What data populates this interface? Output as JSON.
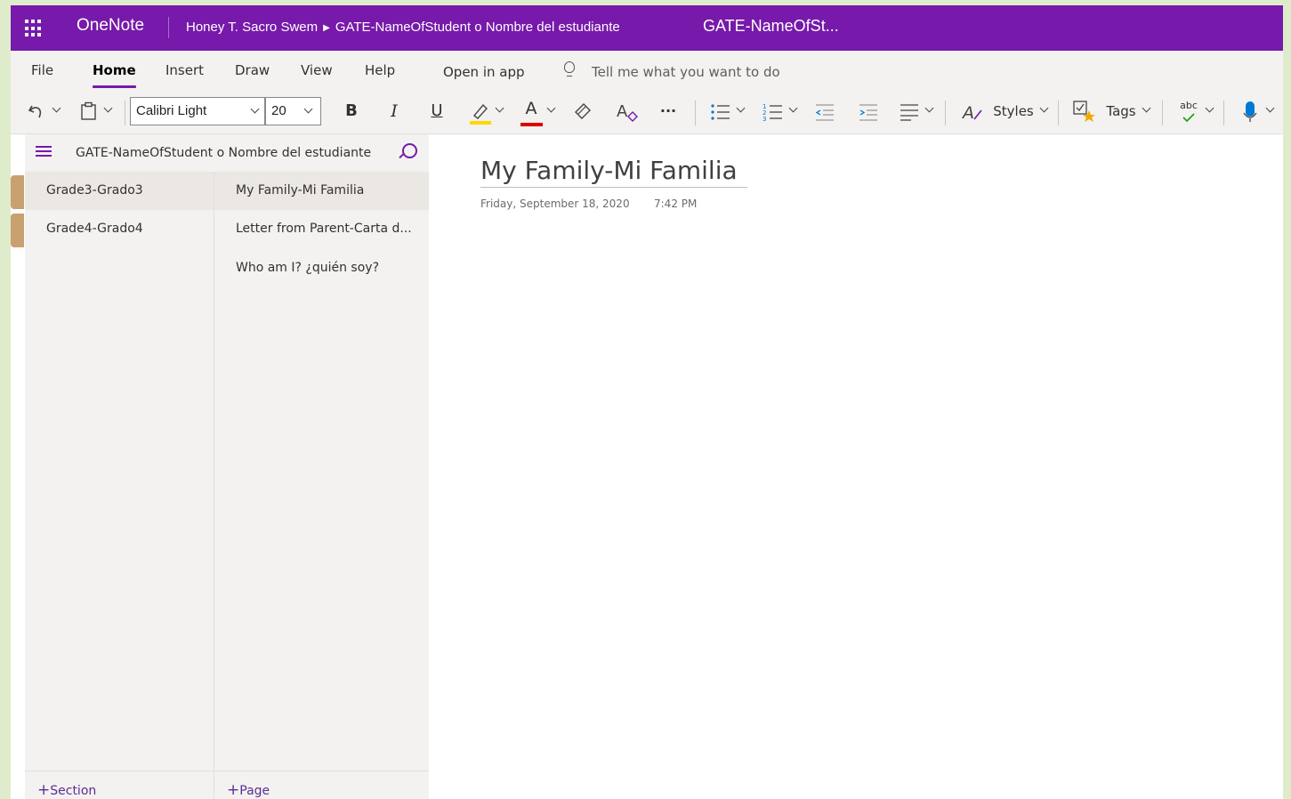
{
  "titlebar": {
    "app_name": "OneNote",
    "breadcrumb_owner": "Honey T. Sacro Swem",
    "breadcrumb_notebook": "GATE-NameOfStudent o Nombre del estudiante",
    "notebook_title": "GATE-NameOfSt..."
  },
  "menu": {
    "items": [
      "File",
      "Home",
      "Insert",
      "Draw",
      "View",
      "Help"
    ],
    "active": "Home",
    "open_in_app": "Open in app",
    "tell_me": "Tell me what you want to do"
  },
  "ribbon": {
    "font_name": "Calibri Light",
    "font_size": "20",
    "bold": "B",
    "italic": "I",
    "underline": "U",
    "font_color_glyph": "A",
    "more": "···",
    "styles_label": "Styles",
    "tags_label": "Tags",
    "spell_glyph": "abc",
    "colors": {
      "highlight": "#ffd800",
      "font_color": "#e00000",
      "accent": "#7719aa"
    }
  },
  "nav": {
    "notebook_name": "GATE-NameOfStudent o Nombre del estudiante",
    "sections": [
      {
        "label": "Grade3-Grado3",
        "selected": true
      },
      {
        "label": "Grade4-Grado4",
        "selected": false
      }
    ],
    "pages": [
      {
        "label": "My Family-Mi Familia",
        "selected": true
      },
      {
        "label": "Letter from Parent-Carta d...",
        "selected": false
      },
      {
        "label": "Who am I? ¿quién soy?",
        "selected": false
      }
    ],
    "add_section": "Section",
    "add_page": "Page"
  },
  "page": {
    "title": "My Family-Mi Familia",
    "date": "Friday, September 18, 2020",
    "time": "7:42 PM"
  }
}
